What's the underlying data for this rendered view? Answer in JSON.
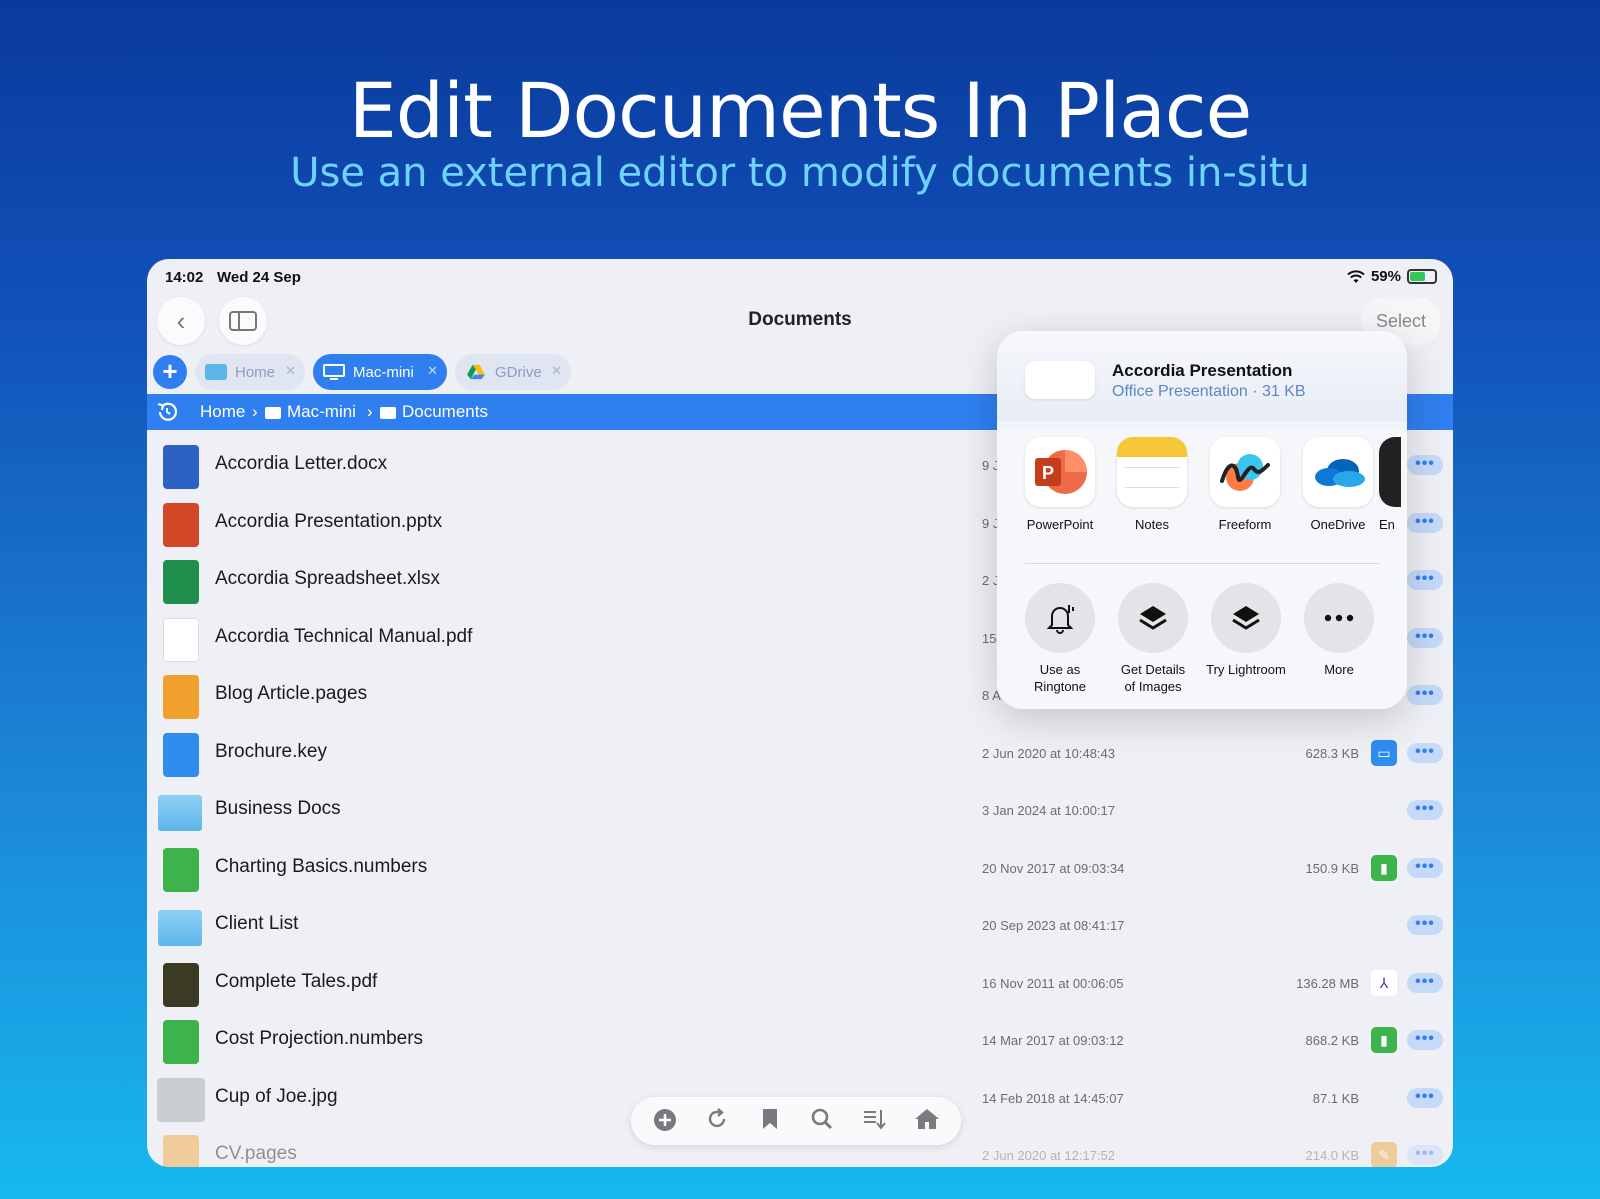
{
  "hero": {
    "title": "Edit Documents In Place",
    "subtitle": "Use an external editor to modify documents in-situ"
  },
  "status_bar": {
    "time": "14:02",
    "date": "Wed 24 Sep",
    "battery": "59%"
  },
  "nav": {
    "title": "Documents",
    "select_label": "Select"
  },
  "tabs": [
    {
      "label": "Home",
      "icon": "folder-icon",
      "active": false
    },
    {
      "label": "Mac-mini",
      "icon": "monitor-icon",
      "active": true
    },
    {
      "label": "GDrive",
      "icon": "google-drive-icon",
      "active": false
    }
  ],
  "breadcrumb": [
    "Home",
    "Mac-mini",
    "Documents"
  ],
  "files": [
    {
      "name": "Accordia Letter.docx",
      "date": "9 J",
      "size": "",
      "icon": "word-doc-icon",
      "color": "#2b62c4"
    },
    {
      "name": "Accordia Presentation.pptx",
      "date": "9 J",
      "size": "",
      "icon": "powerpoint-doc-icon",
      "color": "#d24726"
    },
    {
      "name": "Accordia Spreadsheet.xlsx",
      "date": "2 J",
      "size": "",
      "icon": "excel-doc-icon",
      "color": "#1f8f4e"
    },
    {
      "name": "Accordia Technical Manual.pdf",
      "date": "15",
      "size": "",
      "icon": "pdf-thumbnail-icon",
      "color": "#ffffff"
    },
    {
      "name": "Blog Article.pages",
      "date": "8 A",
      "size": "",
      "icon": "pages-doc-icon",
      "color": "#f0a02c"
    },
    {
      "name": "Brochure.key",
      "date": "2 Jun 2020 at 10:48:43",
      "size": "628.3 KB",
      "icon": "keynote-doc-icon",
      "color": "#2f8df0",
      "badge": "keynote-icon",
      "badge_color": "#2f8df0"
    },
    {
      "name": "Business Docs",
      "date": "3 Jan 2024 at 10:00:17",
      "size": "",
      "icon": "folder-icon",
      "color": "#6fbdee"
    },
    {
      "name": "Charting Basics.numbers",
      "date": "20 Nov 2017 at 09:03:34",
      "size": "150.9 KB",
      "icon": "numbers-doc-icon",
      "color": "#3cb44b",
      "badge": "numbers-icon",
      "badge_color": "#3cb44b"
    },
    {
      "name": "Client List",
      "date": "20 Sep 2023 at 08:41:17",
      "size": "",
      "icon": "folder-icon",
      "color": "#6fbdee"
    },
    {
      "name": "Complete Tales.pdf",
      "date": "16 Nov 2011 at 00:06:05",
      "size": "136.28 MB",
      "icon": "book-cover-icon",
      "color": "#3b3a22",
      "badge": "acrobat-icon",
      "badge_color": "#ffffff"
    },
    {
      "name": "Cost Projection.numbers",
      "date": "14 Mar 2017 at 09:03:12",
      "size": "868.2 KB",
      "icon": "numbers-doc-icon",
      "color": "#3cb44b",
      "badge": "numbers-icon",
      "badge_color": "#3cb44b"
    },
    {
      "name": "Cup of Joe.jpg",
      "date": "14 Feb 2018 at 14:45:07",
      "size": "87.1 KB",
      "icon": "photo-thumbnail-icon",
      "color": "#c9ccd1"
    },
    {
      "name": "CV.pages",
      "date": "2 Jun 2020 at 12:17:52",
      "size": "214.0 KB",
      "icon": "pages-doc-icon",
      "color": "#f0a02c",
      "badge": "pages-icon",
      "badge_color": "#f0a02c",
      "faded": true
    }
  ],
  "share_sheet": {
    "title": "Accordia Presentation",
    "subtitle": "Office Presentation · 31 KB",
    "apps": [
      {
        "label": "PowerPoint",
        "icon": "powerpoint-app-icon"
      },
      {
        "label": "Notes",
        "icon": "notes-app-icon"
      },
      {
        "label": "Freeform",
        "icon": "freeform-app-icon"
      },
      {
        "label": "OneDrive",
        "icon": "onedrive-app-icon"
      },
      {
        "label": "En",
        "icon": "partial-app-icon"
      }
    ],
    "actions": [
      {
        "label_line1": "Use as",
        "label_line2": "Ringtone",
        "icon": "bell-icon"
      },
      {
        "label_line1": "Get Details",
        "label_line2": "of Images",
        "icon": "layers-icon"
      },
      {
        "label_line1": "Try Lightroom",
        "label_line2": "",
        "icon": "layers-icon"
      },
      {
        "label_line1": "More",
        "label_line2": "",
        "icon": "ellipsis-icon"
      }
    ]
  },
  "toolbar": {
    "items": [
      "add-icon",
      "refresh-icon",
      "bookmark-icon",
      "search-icon",
      "sort-icon",
      "home-icon"
    ]
  },
  "colors": {
    "accent": "#2f7ff0",
    "background_top": "#0a3a9c",
    "background_bottom": "#17b8f0",
    "subtitle": "#6fd3ff"
  }
}
